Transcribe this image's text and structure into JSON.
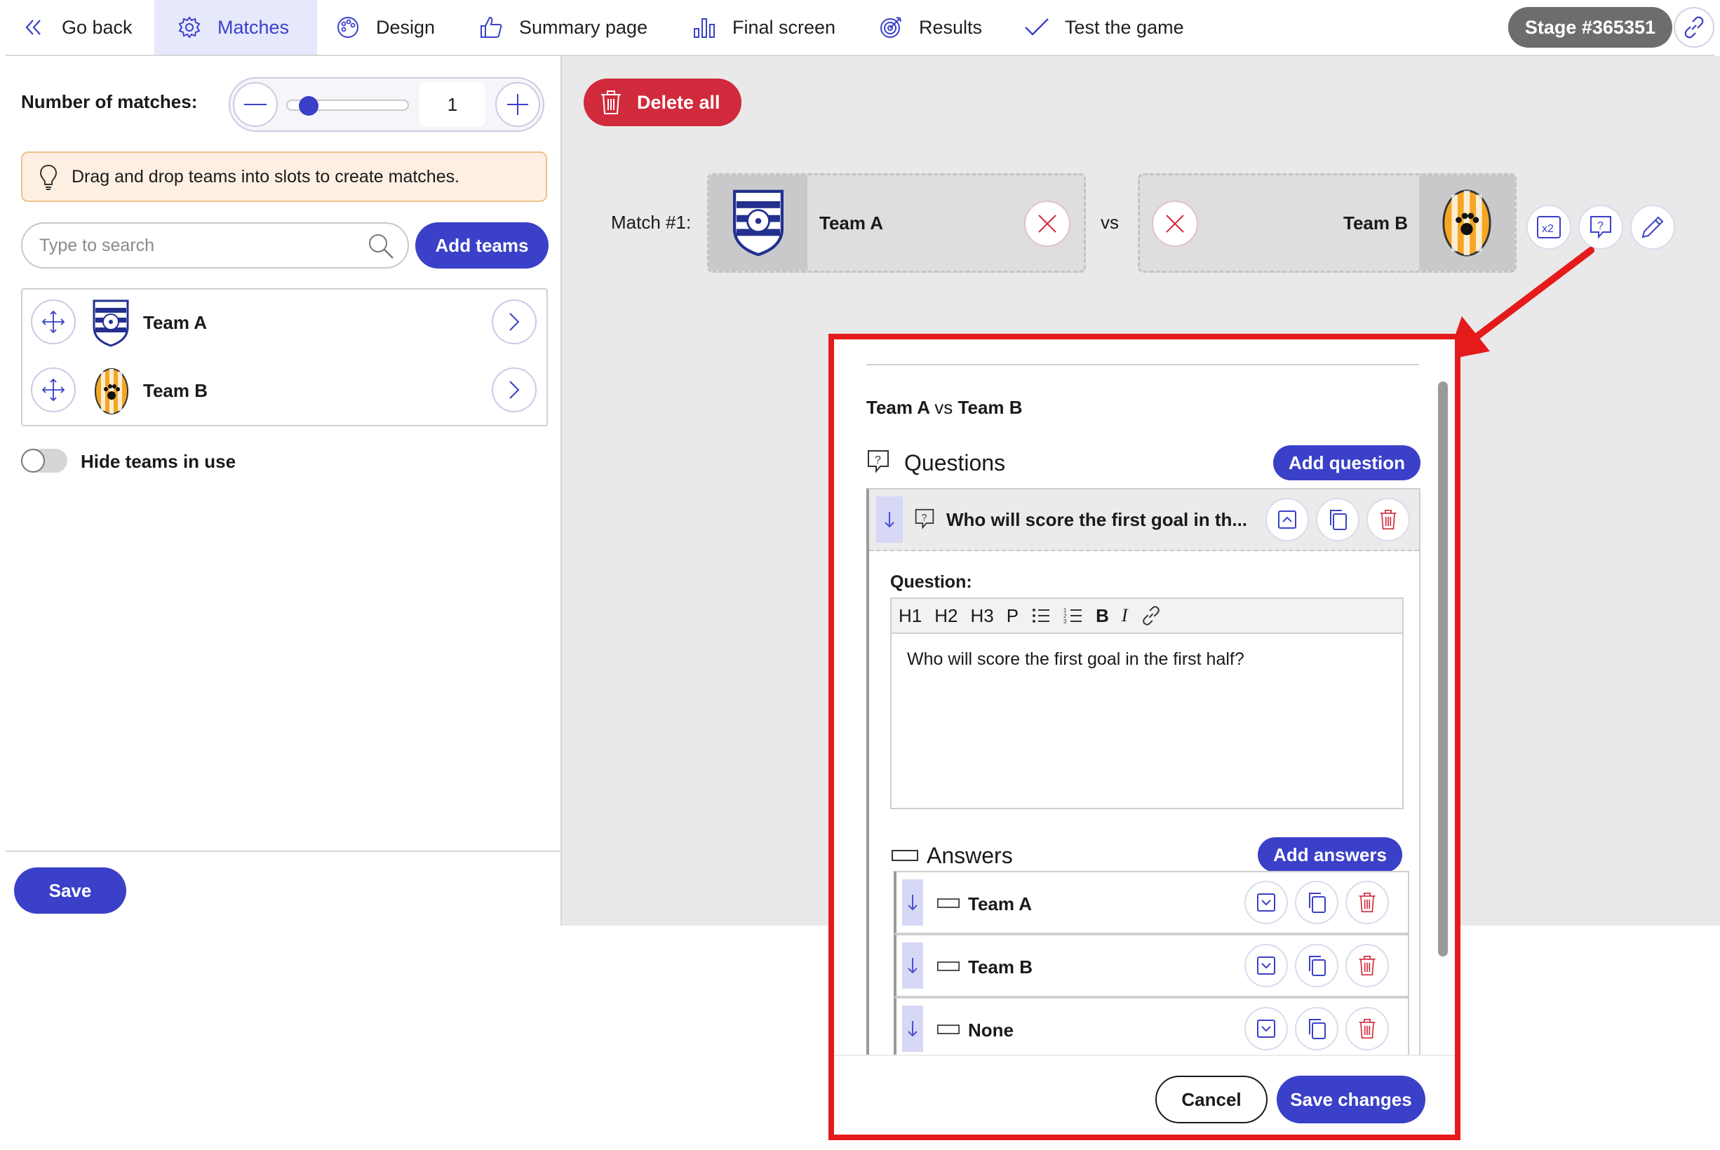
{
  "topbar": {
    "tabs": [
      {
        "label": "Go back",
        "icon": "double-chevron-left-icon"
      },
      {
        "label": "Matches",
        "icon": "gear-icon",
        "active": true
      },
      {
        "label": "Design",
        "icon": "palette-icon"
      },
      {
        "label": "Summary page",
        "icon": "thumbs-up-icon"
      },
      {
        "label": "Final screen",
        "icon": "bar-chart-icon"
      },
      {
        "label": "Results",
        "icon": "target-icon"
      },
      {
        "label": "Test the game",
        "icon": "checkmark-icon"
      }
    ],
    "stage_label": "Stage #365351",
    "link_icon": "link-icon"
  },
  "left": {
    "matches_label": "Number of matches:",
    "matches_value": "1",
    "slider_fraction": 0.05,
    "tip_text": "Drag and drop teams into slots to create matches.",
    "search_placeholder": "Type to search",
    "add_teams_label": "Add teams",
    "teams": [
      {
        "name": "Team A"
      },
      {
        "name": "Team B"
      }
    ],
    "hide_toggle_label": "Hide teams in use",
    "hide_toggle_on": false,
    "save_label": "Save"
  },
  "main": {
    "delete_all_label": "Delete all",
    "match_label": "Match #1:",
    "team_a": "Team A",
    "team_b": "Team B",
    "vs_label": "vs"
  },
  "modal": {
    "title": "Team A vs Team B",
    "title_team_a": "Team A",
    "title_vs": "vs",
    "title_team_b": "Team B",
    "questions_heading": "Questions",
    "add_question_label": "Add question",
    "question_collapsed_text": "Who will score the first goal in th...",
    "question_label": "Question:",
    "toolbar": [
      "H1",
      "H2",
      "H3",
      "P",
      "ul",
      "ol",
      "B",
      "I",
      "link"
    ],
    "question_text": "Who will score the first goal in the first half?",
    "answers_heading": "Answers",
    "add_answers_label": "Add answers",
    "answers": [
      {
        "label": "Team A"
      },
      {
        "label": "Team B"
      },
      {
        "label": "None"
      }
    ],
    "cancel_label": "Cancel",
    "save_changes_label": "Save changes"
  },
  "colors": {
    "accent": "#3a40c8",
    "danger": "#d12a3c",
    "highlight_border": "#e51b1b",
    "tip_bg": "#fdf0e3"
  }
}
